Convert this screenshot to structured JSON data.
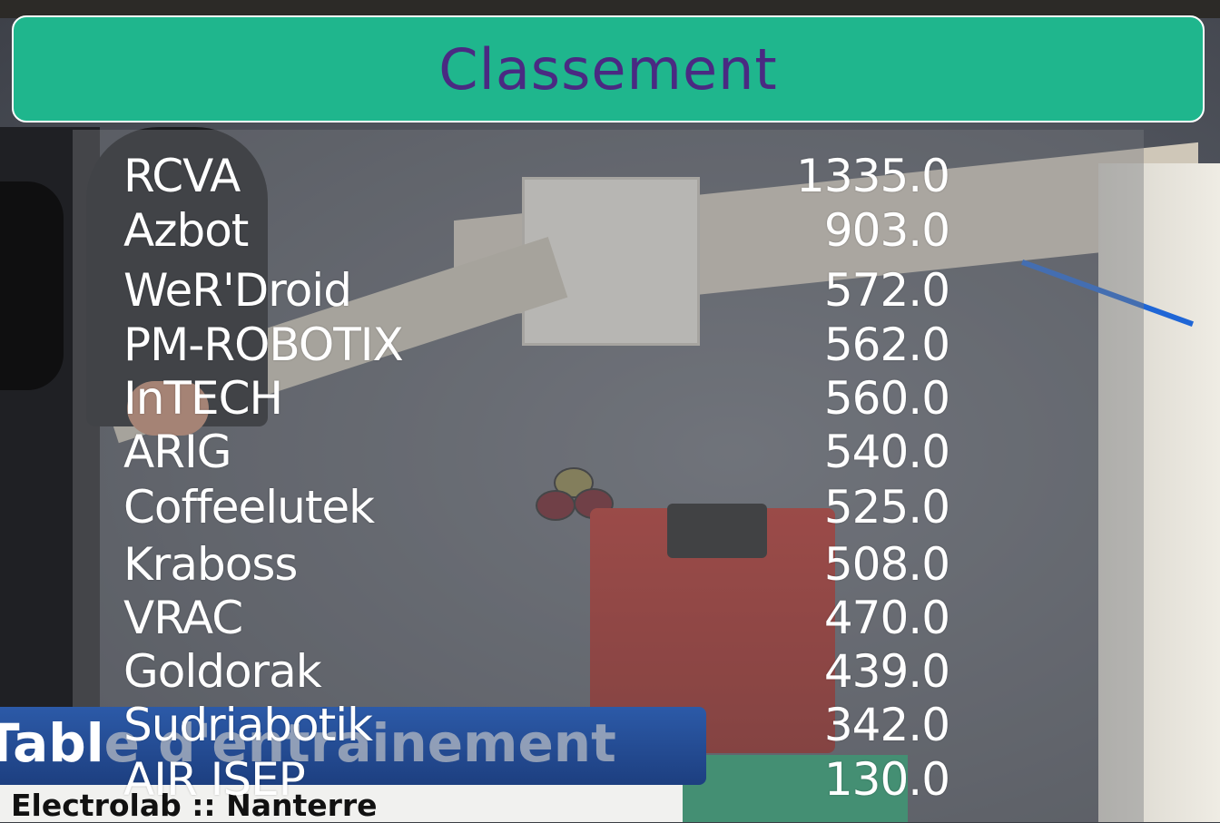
{
  "header": {
    "title": "Classement"
  },
  "ranking": [
    {
      "team": "RCVA",
      "score": "1335.0"
    },
    {
      "team": "Azbot",
      "score": "903.0"
    },
    {
      "team": "WeR'Droid",
      "score": "572.0"
    },
    {
      "team": "PM-ROBOTIX",
      "score": "562.0"
    },
    {
      "team": "InTECH",
      "score": "560.0"
    },
    {
      "team": "ARIG",
      "score": "540.0"
    },
    {
      "team": "Coffeelutek",
      "score": "525.0"
    },
    {
      "team": "Kraboss",
      "score": "508.0"
    },
    {
      "team": "VRAC",
      "score": "470.0"
    },
    {
      "team": "Goldorak",
      "score": "439.0"
    },
    {
      "team": "Sudriabotik",
      "score": "342.0"
    },
    {
      "team": "AIR ISEP",
      "score": "130.0"
    }
  ],
  "lower_third": {
    "title_visible": "Tabl",
    "title_tail": "e d'entrainement",
    "subtitle": "Electrolab :: Nanterre"
  },
  "colors": {
    "header_bg": "#1fb68d",
    "header_text": "#4a2a82",
    "lower_third_bg": "#2c5aa8"
  }
}
